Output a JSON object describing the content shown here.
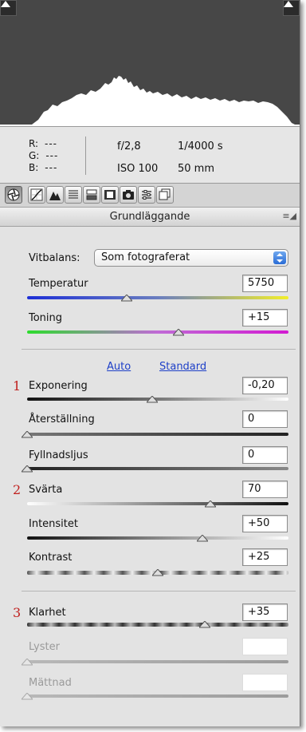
{
  "histogram": {
    "collapse_left_icon": "triangle-up-icon",
    "collapse_right_icon": "triangle-up-icon"
  },
  "info": {
    "r_label": "R:",
    "r_value": "---",
    "g_label": "G:",
    "g_value": "---",
    "b_label": "B:",
    "b_value": "---",
    "aperture": "f/2,8",
    "shutter": "1/4000 s",
    "iso": "ISO 100",
    "focal": "50 mm"
  },
  "tabs": [
    {
      "icon": "aperture-icon",
      "active": true
    },
    {
      "icon": "tone-curve-icon"
    },
    {
      "icon": "detail-icon"
    },
    {
      "icon": "hsl-icon"
    },
    {
      "icon": "split-toning-icon"
    },
    {
      "icon": "lens-correction-icon"
    },
    {
      "icon": "camera-calibration-icon"
    },
    {
      "icon": "presets-icon"
    },
    {
      "icon": "snapshots-icon"
    }
  ],
  "section": {
    "title": "Grundläggande",
    "menu_icon": "panel-menu-icon"
  },
  "white_balance": {
    "label": "Vitbalans:",
    "selected": "Som fotograferat"
  },
  "sliders_wb": [
    {
      "label": "Temperatur",
      "value": "5750",
      "position": 0.38,
      "track": "temperature"
    },
    {
      "label": "Toning",
      "value": "+15",
      "position": 0.58,
      "track": "tint"
    }
  ],
  "auto_label": "Auto",
  "standard_label": "Standard",
  "sliders_tone": [
    {
      "label": "Exponering",
      "value": "-0,20",
      "position": 0.48,
      "track": "exposure",
      "marker": "1"
    },
    {
      "label": "Återställning",
      "value": "0",
      "position": 0.0,
      "track": "recovery"
    },
    {
      "label": "Fyllnadsljus",
      "value": "0",
      "position": 0.0,
      "track": "fill"
    },
    {
      "label": "Svärta",
      "value": "70",
      "position": 0.7,
      "track": "blacks",
      "marker": "2"
    },
    {
      "label": "Intensitet",
      "value": "+50",
      "position": 0.67,
      "track": "brightness"
    },
    {
      "label": "Kontrast",
      "value": "+25",
      "position": 0.5,
      "track": "contrast"
    }
  ],
  "sliders_presence": [
    {
      "label": "Klarhet",
      "value": "+35",
      "position": 0.68,
      "track": "clarity",
      "marker": "3"
    },
    {
      "label": "Lyster",
      "value": "",
      "position": 0.0,
      "track": "vibrance",
      "disabled": true
    },
    {
      "label": "Mättnad",
      "value": "",
      "position": 0.0,
      "track": "saturation",
      "disabled": true
    }
  ],
  "colors": {
    "annotation": "#c0201e",
    "link": "#1d3fc8",
    "histogram_bg": "#474747"
  }
}
